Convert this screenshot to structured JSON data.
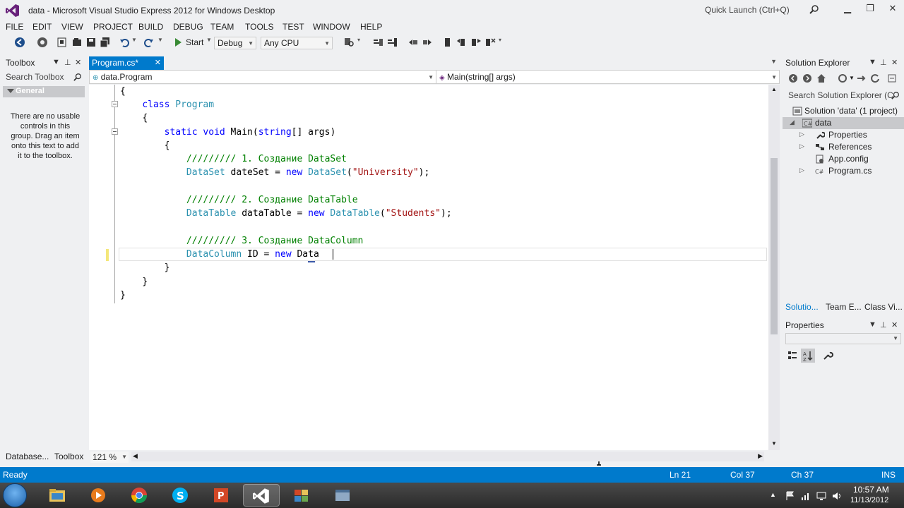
{
  "window": {
    "title": "data - Microsoft Visual Studio Express 2012 for Windows Desktop",
    "quick_launch_placeholder": "Quick Launch (Ctrl+Q)"
  },
  "menu": [
    "FILE",
    "EDIT",
    "VIEW",
    "PROJECT",
    "BUILD",
    "DEBUG",
    "TEAM",
    "TOOLS",
    "TEST",
    "WINDOW",
    "HELP"
  ],
  "toolbar": {
    "start_label": "Start",
    "config": "Debug",
    "platform": "Any CPU"
  },
  "toolbox": {
    "title": "Toolbox",
    "search_placeholder": "Search Toolbox",
    "group": "General",
    "empty_message": "There are no usable controls in this group. Drag an item onto this text to add it to the toolbox.",
    "bottom_tabs": [
      "Database...",
      "Toolbox"
    ]
  },
  "editor": {
    "tab_label": "Program.cs*",
    "nav_left": "data.Program",
    "nav_right": "Main(string[] args)",
    "zoom": "121 %",
    "code": {
      "l1": "{",
      "l2_kw": "class",
      "l2_rest": " Program",
      "l3": "{",
      "l4_kw1": "static",
      "l4_kw2": "void",
      "l4_rest1": " Main(",
      "l4_kw3": "string",
      "l4_rest2": "[] args)",
      "l5": "{",
      "l6": "///////// 1. Создание DataSet",
      "l7_ty": "DataSet",
      "l7_mid": " dateSet = ",
      "l7_kw": "new",
      "l7_ty2": " DataSet",
      "l7_open": "(",
      "l7_str": "\"University\"",
      "l7_end": ");",
      "l9": "///////// 2. Создание DataTable",
      "l10_ty": "DataTable",
      "l10_mid": " dataTable = ",
      "l10_kw": "new",
      "l10_ty2": " DataTable",
      "l10_open": "(",
      "l10_str": "\"Students\"",
      "l10_end": ");",
      "l12": "///////// 3. Создание DataColumn",
      "l13_ty": "DataColumn",
      "l13_mid": " ID = ",
      "l13_kw": "new",
      "l13_rest": " Data",
      "l14": "}",
      "l15": "}",
      "l16": "}"
    }
  },
  "solution_explorer": {
    "title": "Solution Explorer",
    "search_placeholder": "Search Solution Explorer (C",
    "tree": [
      {
        "label": "Solution 'data' (1 project)",
        "expander": ""
      },
      {
        "label": "data",
        "expander": "◢"
      },
      {
        "label": "Properties",
        "expander": "▷"
      },
      {
        "label": "References",
        "expander": "▷"
      },
      {
        "label": "App.config",
        "expander": ""
      },
      {
        "label": "Program.cs",
        "expander": "▷"
      }
    ],
    "tabs": [
      "Solutio...",
      "Team E...",
      "Class Vi..."
    ]
  },
  "properties": {
    "title": "Properties"
  },
  "status": {
    "ready": "Ready",
    "ln": "Ln 21",
    "col": "Col 37",
    "ch": "Ch 37",
    "ins": "INS"
  },
  "taskbar": {
    "time": "10:57 AM",
    "date": "11/13/2012"
  },
  "colors": {
    "accent": "#007acc",
    "keyword": "#0000ff",
    "type": "#2b91af",
    "string": "#a31515",
    "comment": "#008000"
  }
}
